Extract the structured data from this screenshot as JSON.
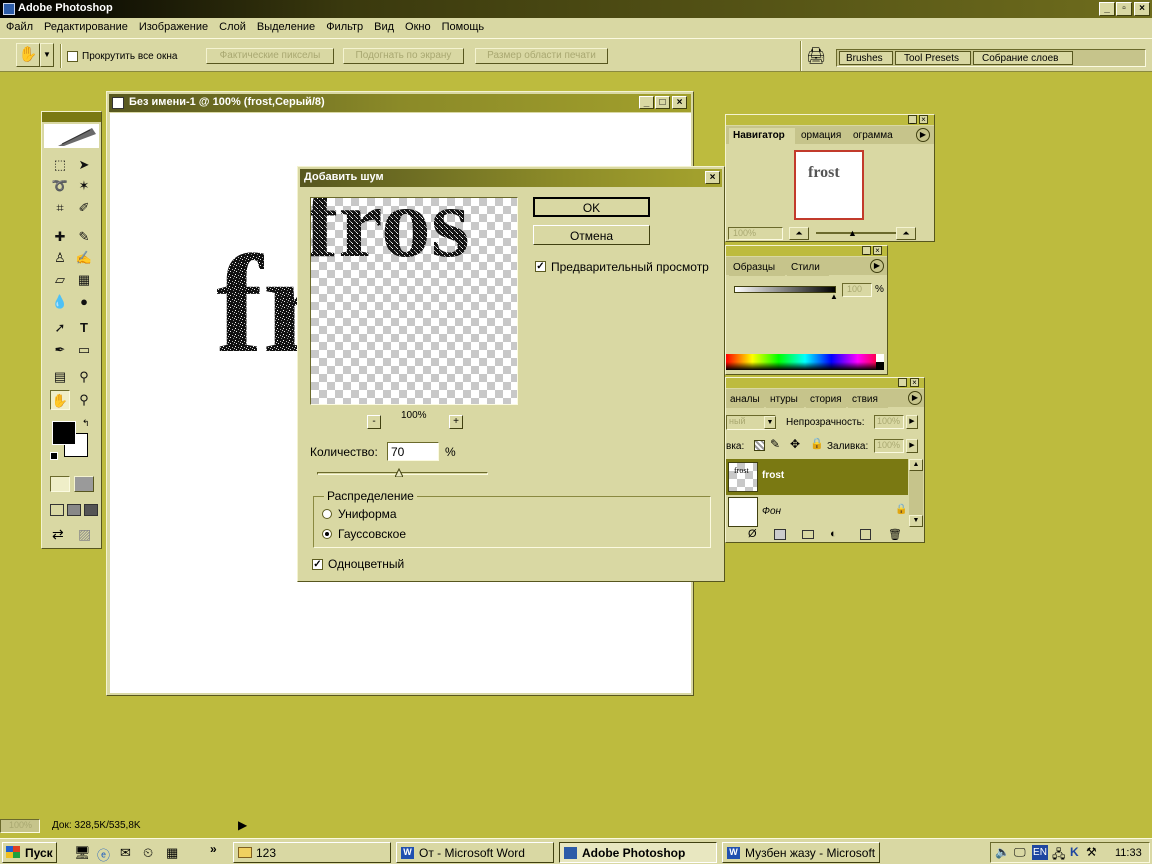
{
  "app": {
    "title": "Adobe Photoshop",
    "menu": [
      "Файл",
      "Редактирование",
      "Изображение",
      "Слой",
      "Выделение",
      "Фильтр",
      "Вид",
      "Окно",
      "Помощь"
    ]
  },
  "options_bar": {
    "scroll_all_label": "Прокрутить все окна",
    "btn_actual": "Фактические пикселы",
    "btn_fit": "Подогнать по экрану",
    "btn_print": "Размер области печати",
    "well_tabs": [
      "Brushes",
      "Tool Presets",
      "Собрание слоев"
    ]
  },
  "document": {
    "title": "Без имени-1 @ 100% (frost,Серый/8)",
    "text": "fr"
  },
  "dialog": {
    "title": "Добавить шум",
    "ok": "OK",
    "cancel": "Отмена",
    "preview_label": "Предварительный просмотр",
    "preview_text": "fros",
    "zoom_minus": "-",
    "zoom_value": "100%",
    "zoom_plus": "+",
    "amount_label": "Количество:",
    "amount_value": "70",
    "amount_unit": "%",
    "amount_slider_fraction": 0.48,
    "distribution_label": "Распределение",
    "uniform_label": "Униформа",
    "gaussian_label": "Гауссовское",
    "mono_label": "Одноцветный"
  },
  "navigator": {
    "tabs": [
      "Навигатор",
      "ормация",
      "ограмма"
    ],
    "thumb_text": "frost",
    "zoom": "100%"
  },
  "color_palette": {
    "tabs": [
      "Образцы",
      "Стили"
    ],
    "value": "100",
    "unit": "%"
  },
  "layers": {
    "tabs": [
      "аналы",
      "нтуры",
      "стория",
      "ствия"
    ],
    "blend_mode": "ный",
    "opacity_label": "Непрозрачность:",
    "opacity_value": "100%",
    "lock_label": "вка:",
    "fill_label": "Заливка:",
    "fill_value": "100%",
    "items": [
      {
        "name": "frost",
        "thumb": "frost"
      },
      {
        "name": "Фон",
        "thumb": ""
      }
    ]
  },
  "status": {
    "zoom": "100%",
    "doc": "Док: 328,5K/535,8K"
  },
  "taskbar": {
    "start": "Пуск",
    "chevron": "»",
    "tasks": [
      "123",
      "От - Microsoft Word",
      "Adobe Photoshop",
      "Музбен жазу - Microsoft ..."
    ],
    "lang": "EN",
    "clock": "11:33"
  },
  "colors": {
    "desktop": "#bdbb3e",
    "face": "#d9d8a3",
    "title_active": "#8b8a28",
    "layer_selected": "#7a7912"
  }
}
